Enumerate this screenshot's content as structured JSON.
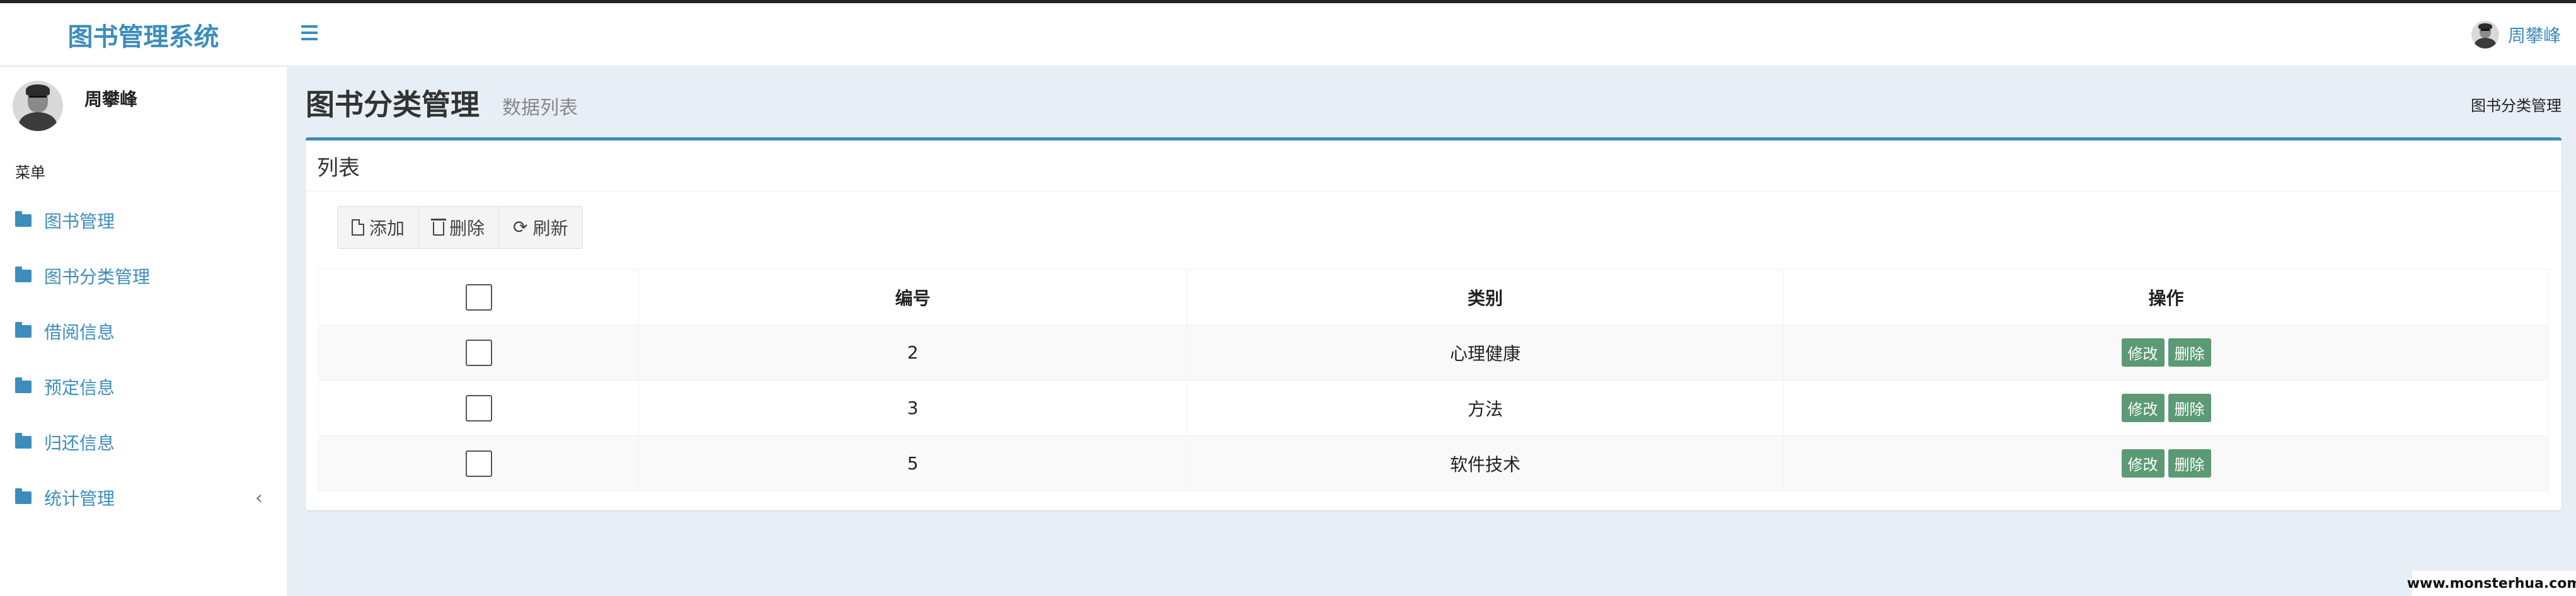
{
  "app": {
    "brand": "图书管理系统"
  },
  "header": {
    "user_name": "周攀峰"
  },
  "sidebar": {
    "user_name": "周攀峰",
    "menu_header": "菜单",
    "items": [
      {
        "label": "图书管理"
      },
      {
        "label": "图书分类管理"
      },
      {
        "label": "借阅信息"
      },
      {
        "label": "预定信息"
      },
      {
        "label": "归还信息"
      },
      {
        "label": "统计管理"
      }
    ]
  },
  "page": {
    "title": "图书分类管理",
    "subtitle": "数据列表",
    "breadcrumb": "图书分类管理"
  },
  "box": {
    "title": "列表",
    "toolbar": {
      "add_label": "添加",
      "delete_label": "删除",
      "refresh_label": "刷新"
    }
  },
  "table": {
    "columns": [
      "编号",
      "类别",
      "操作"
    ],
    "rows": [
      {
        "id": "2",
        "category": "心理健康",
        "edit": "修改",
        "delete": "删除"
      },
      {
        "id": "3",
        "category": "方法",
        "edit": "修改",
        "delete": "删除"
      },
      {
        "id": "5",
        "category": "软件技术",
        "edit": "修改",
        "delete": "删除"
      }
    ]
  },
  "watermark": "www.monsterhua.com",
  "colors": {
    "accent": "#3c8dbc",
    "action_button": "#5b9a74",
    "background": "#e8eef6"
  },
  "icons": [
    "menu-icon",
    "folder-icon",
    "chevron-left-icon",
    "file-icon",
    "trash-icon",
    "refresh-icon"
  ]
}
